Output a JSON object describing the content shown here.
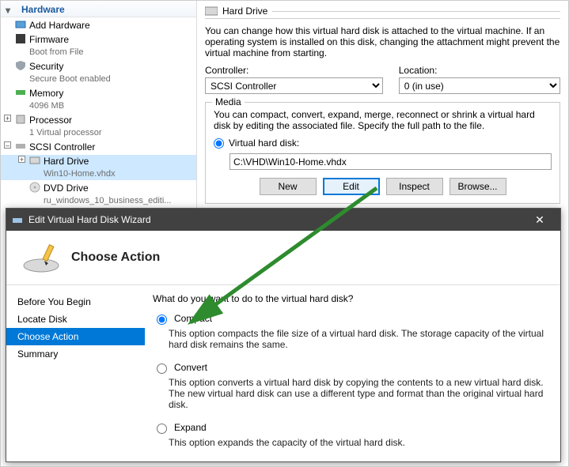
{
  "tree": {
    "header": "Hardware",
    "items": [
      {
        "label": "Add Hardware",
        "sub": ""
      },
      {
        "label": "Firmware",
        "sub": "Boot from File"
      },
      {
        "label": "Security",
        "sub": "Secure Boot enabled"
      },
      {
        "label": "Memory",
        "sub": "4096 MB"
      },
      {
        "label": "Processor",
        "sub": "1 Virtual processor"
      },
      {
        "label": "SCSI Controller",
        "sub": ""
      },
      {
        "label": "Hard Drive",
        "sub": "Win10-Home.vhdx"
      },
      {
        "label": "DVD Drive",
        "sub": "ru_windows_10_business_editi..."
      }
    ]
  },
  "pane": {
    "section": "Hard Drive",
    "desc": "You can change how this virtual hard disk is attached to the virtual machine. If an operating system is installed on this disk, changing the attachment might prevent the virtual machine from starting.",
    "controller_label": "Controller:",
    "controller_value": "SCSI Controller",
    "location_label": "Location:",
    "location_value": "0 (in use)",
    "media_legend": "Media",
    "media_desc": "You can compact, convert, expand, merge, reconnect or shrink a virtual hard disk by editing the associated file. Specify the full path to the file.",
    "vhd_radio": "Virtual hard disk:",
    "vhd_path": "C:\\VHD\\Win10-Home.vhdx",
    "btn_new": "New",
    "btn_edit": "Edit",
    "btn_inspect": "Inspect",
    "btn_browse": "Browse..."
  },
  "wizard": {
    "title": "Edit Virtual Hard Disk Wizard",
    "header": "Choose Action",
    "steps": [
      "Before You Begin",
      "Locate Disk",
      "Choose Action",
      "Summary"
    ],
    "active_step": 2,
    "question": "What do you want to do to the virtual hard disk?",
    "options": [
      {
        "name": "Compact",
        "desc": "This option compacts the file size of a virtual hard disk. The storage capacity of the virtual hard disk remains the same."
      },
      {
        "name": "Convert",
        "desc": "This option converts a virtual hard disk by copying the contents to a new virtual hard disk. The new virtual hard disk can use a different type and format than the original virtual hard disk."
      },
      {
        "name": "Expand",
        "desc": "This option expands the capacity of the virtual hard disk."
      }
    ],
    "selected_option": 0
  }
}
